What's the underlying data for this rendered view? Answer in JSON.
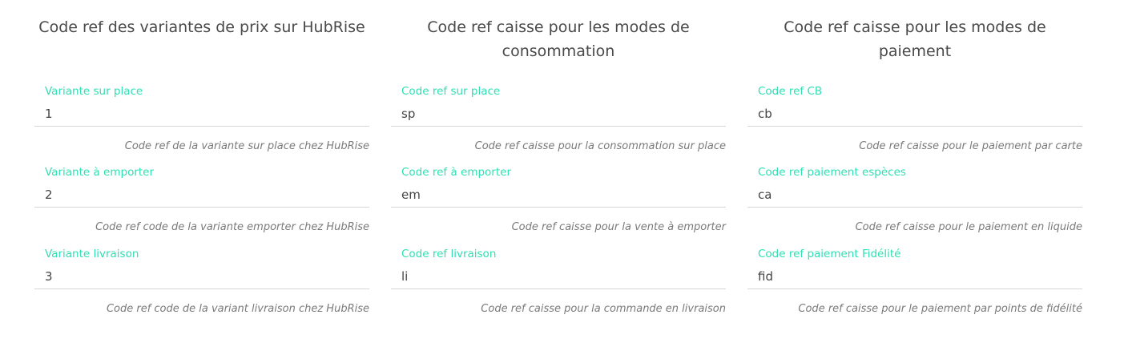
{
  "columns": [
    {
      "title": "Code ref des variantes de prix sur HubRise",
      "fields": [
        {
          "label": "Variante sur place",
          "value": "1",
          "hint": "Code ref de la variante sur place chez HubRise"
        },
        {
          "label": "Variante à emporter",
          "value": "2",
          "hint": "Code ref code de la variante emporter chez HubRise"
        },
        {
          "label": "Variante livraison",
          "value": "3",
          "hint": "Code ref code de la variant livraison chez HubRise"
        }
      ]
    },
    {
      "title": "Code ref caisse pour les modes de consommation",
      "fields": [
        {
          "label": "Code ref sur place",
          "value": "sp",
          "hint": "Code ref caisse pour la consommation sur place"
        },
        {
          "label": "Code ref à emporter",
          "value": "em",
          "hint": "Code ref caisse pour la vente à emporter"
        },
        {
          "label": "Code ref livraison",
          "value": "li",
          "hint": "Code ref caisse pour la commande en livraison"
        }
      ]
    },
    {
      "title": "Code ref caisse pour les modes de paiement",
      "fields": [
        {
          "label": "Code ref CB",
          "value": "cb",
          "hint": "Code ref caisse pour le paiement par carte"
        },
        {
          "label": "Code ref paiement espèces",
          "value": "ca",
          "hint": "Code ref caisse pour le paiement en liquide"
        },
        {
          "label": "Code ref paiement Fidélité",
          "value": "fid",
          "hint": "Code ref caisse pour le paiement par points de fidélité"
        }
      ]
    }
  ],
  "colors": {
    "label": "#2ee0b3",
    "title": "#4a4a4a",
    "hint": "#7a7a7a",
    "underline": "#d6d6d6"
  }
}
